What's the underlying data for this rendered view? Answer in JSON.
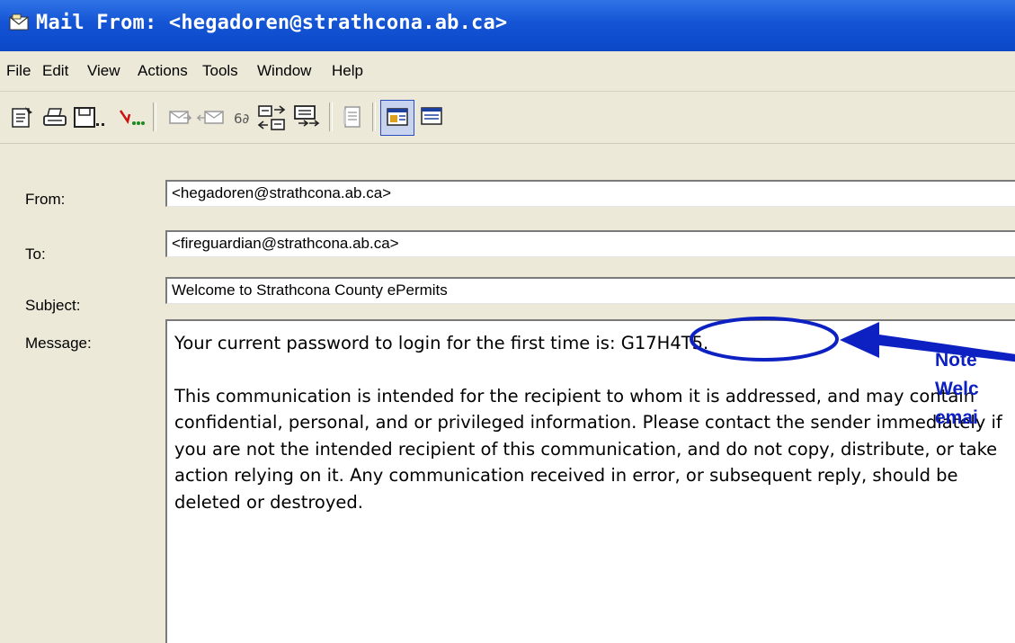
{
  "window": {
    "title": "Mail From: <hegadoren@strathcona.ab.ca>"
  },
  "menu": [
    "File",
    "Edit",
    "View",
    "Actions",
    "Tools",
    "Window",
    "Help"
  ],
  "toolbar": {
    "icons": [
      "properties-icon",
      "print-icon",
      "save-icon",
      "forward-recipients-icon",
      "reply-icon",
      "reply-all-icon",
      "forward-icon",
      "attachments-icon",
      "organize-icon",
      "move-icon",
      "address-book-icon",
      "view-normal-icon",
      "view-preview-icon"
    ]
  },
  "form": {
    "from_label": "From:",
    "from_value": "<hegadoren@strathcona.ab.ca>",
    "to_label": "To:",
    "to_value": "<fireguardian@strathcona.ab.ca>",
    "subject_label": "Subject:",
    "subject_value": "Welcome to Strathcona County ePermits",
    "message_label": "Message:",
    "message_line1": "Your current password to login for the first time is: G17H4T5.",
    "message_body": "This communication is intended for the recipient to whom it is addressed, and may contain confidential, personal, and or privileged information. Please contact the sender immediately if you are not the intended recipient of this communication, and do not copy, distribute, or take action relying on it. Any communication received in error, or subsequent reply, should be deleted or destroyed."
  },
  "annotation": {
    "line1": "Note",
    "line2": "Welc",
    "line3": "emai",
    "color": "#0d21c2"
  }
}
